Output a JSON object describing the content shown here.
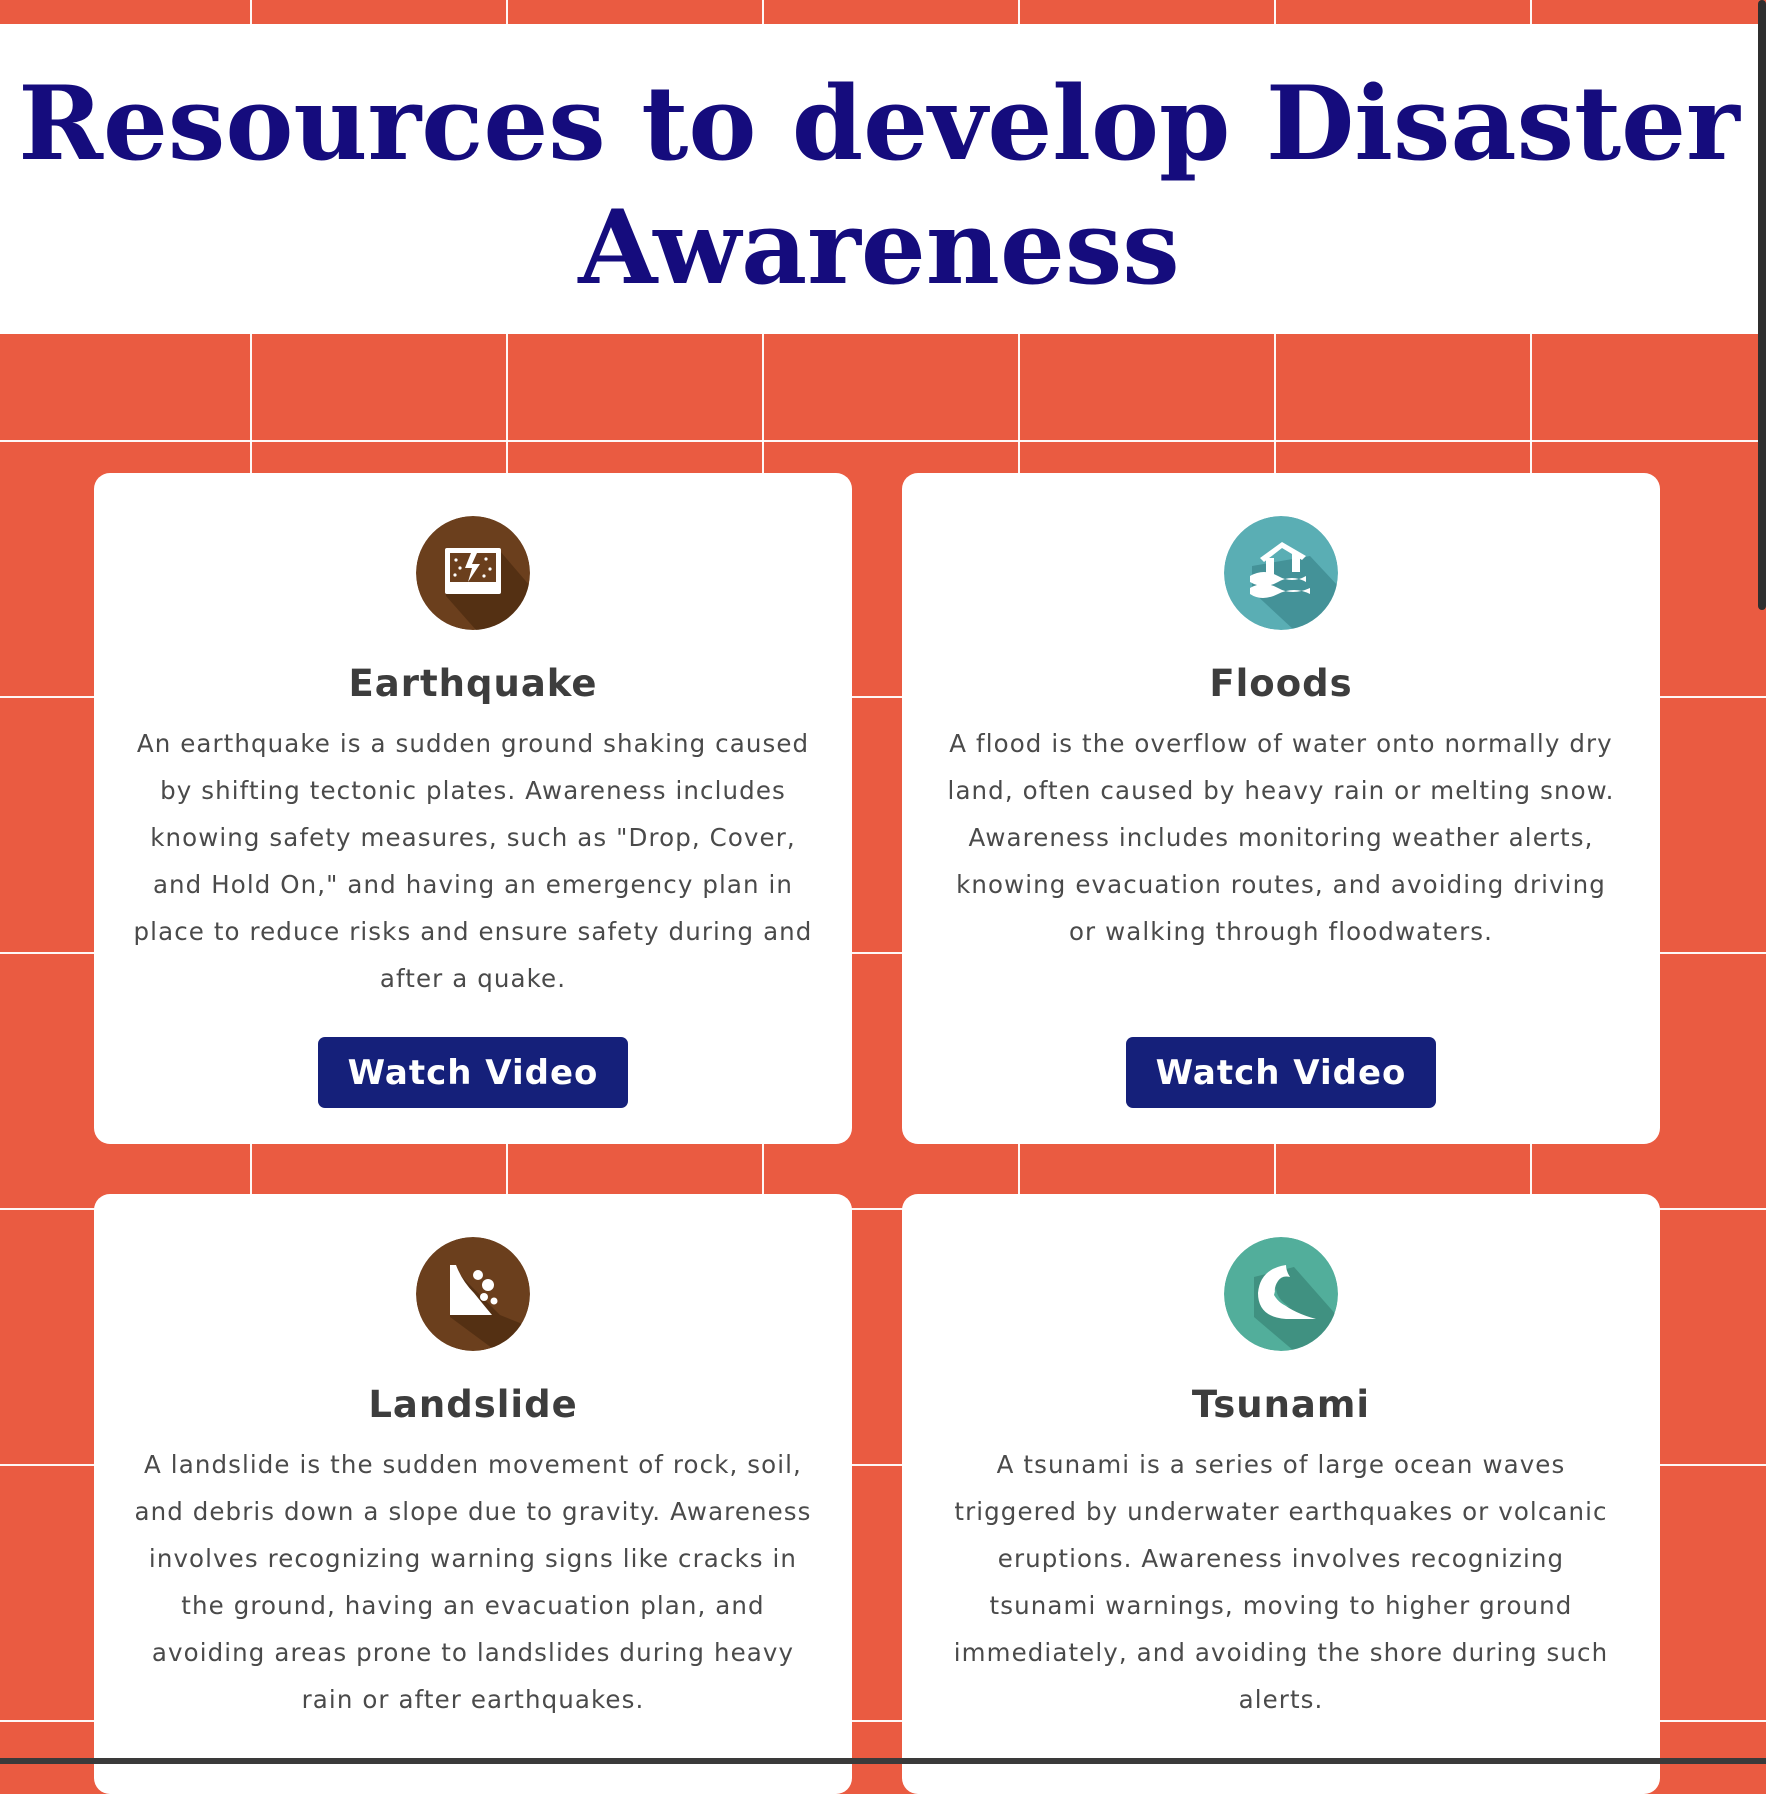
{
  "page": {
    "title": "Resources to develop Disaster Awareness"
  },
  "colors": {
    "background": "#ea5b41",
    "title": "#150c7d",
    "button": "#15207a",
    "earth_icon": "#6b3f1d",
    "flood_icon": "#5aaeb4",
    "tsunami_icon": "#52ae9b"
  },
  "cards": [
    {
      "icon": "earthquake-icon",
      "title": "Earthquake",
      "description": "An earthquake is a sudden ground shaking caused by shifting tectonic plates. Awareness includes knowing safety measures, such as \"Drop, Cover, and Hold On,\" and having an emergency plan in place to reduce risks and ensure safety during and after a quake.",
      "button_label": "Watch Video"
    },
    {
      "icon": "flood-icon",
      "title": "Floods",
      "description": "A flood is the overflow of water onto normally dry land, often caused by heavy rain or melting snow. Awareness includes monitoring weather alerts, knowing evacuation routes, and avoiding driving or walking through floodwaters.",
      "button_label": "Watch Video"
    },
    {
      "icon": "landslide-icon",
      "title": "Landslide",
      "description": "A landslide is the sudden movement of rock, soil, and debris down a slope due to gravity. Awareness involves recognizing warning signs like cracks in the ground, having an evacuation plan, and avoiding areas prone to landslides during heavy rain or after earthquakes."
    },
    {
      "icon": "tsunami-icon",
      "title": "Tsunami",
      "description": "A tsunami is a series of large ocean waves triggered by underwater earthquakes or volcanic eruptions. Awareness involves recognizing tsunami warnings, moving to higher ground immediately, and avoiding the shore during such alerts."
    }
  ]
}
